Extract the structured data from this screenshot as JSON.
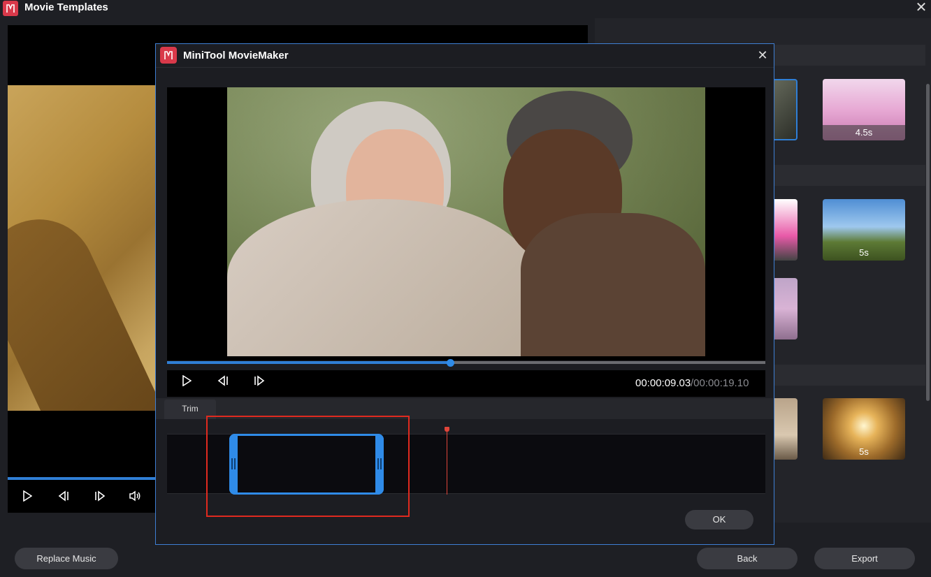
{
  "app": {
    "title": "Movie Templates",
    "close_icon": "close-icon"
  },
  "background_player": {
    "controls": [
      "play-icon",
      "previous-frame-icon",
      "next-frame-icon",
      "volume-icon"
    ]
  },
  "right_panel": {
    "thumbnails": [
      {
        "duration": "4.5s",
        "selected": false
      },
      {
        "duration": "5s",
        "selected": false
      },
      {
        "duration": "5s",
        "selected": false
      }
    ]
  },
  "bottom": {
    "replace_music_label": "Replace Music",
    "back_label": "Back",
    "export_label": "Export"
  },
  "dialog": {
    "title": "MiniTool MovieMaker",
    "close_icon": "close-icon",
    "player": {
      "current_time": "00:00:09.03",
      "total_time": "/00:00:19.10",
      "progress_fraction": 0.473,
      "controls": [
        "play-icon",
        "previous-frame-icon",
        "next-frame-icon"
      ]
    },
    "trim": {
      "tab_label": "Trim",
      "playhead_fraction": 0.467
    },
    "ok_label": "OK"
  },
  "colors": {
    "accent_blue": "#2f8be8",
    "highlight_red": "#e02a1f",
    "playhead_red": "#e0453a",
    "brand_red": "#d9394a"
  }
}
